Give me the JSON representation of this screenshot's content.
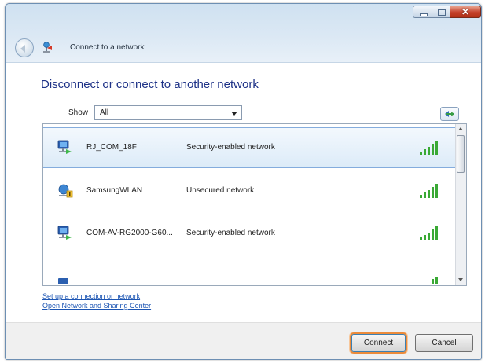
{
  "window": {
    "title": "Connect to a network",
    "controls": {
      "minimize_icon": "minimize-icon",
      "maximize_icon": "maximize-icon",
      "close_glyph": "✕"
    }
  },
  "main": {
    "heading": "Disconnect or connect to another network",
    "show": {
      "label": "Show",
      "selected": "All"
    },
    "refresh_icon": "refresh-icon"
  },
  "networks": [
    {
      "name": "RJ_COM_18F",
      "status": "Security-enabled network",
      "icon": "secured-network-icon",
      "selected": true,
      "signal_bars": 5
    },
    {
      "name": "SamsungWLAN",
      "status": "Unsecured network",
      "icon": "unsecured-network-icon",
      "selected": false,
      "signal_bars": 5
    },
    {
      "name": "COM-AV-RG2000-G60...",
      "status": "Security-enabled network",
      "icon": "secured-network-icon",
      "selected": false,
      "signal_bars": 5
    },
    {
      "name": "",
      "status": "",
      "icon": "network-icon",
      "selected": false,
      "signal_bars": 2
    }
  ],
  "links": {
    "setup": "Set up a connection or network",
    "sharing_center": "Open Network and Sharing Center"
  },
  "buttons": {
    "connect": "Connect",
    "cancel": "Cancel"
  },
  "colors": {
    "heading": "#1e3287",
    "link": "#1c55b3",
    "signal": "#3aa935",
    "focus_ring": "#ec8b3b"
  }
}
